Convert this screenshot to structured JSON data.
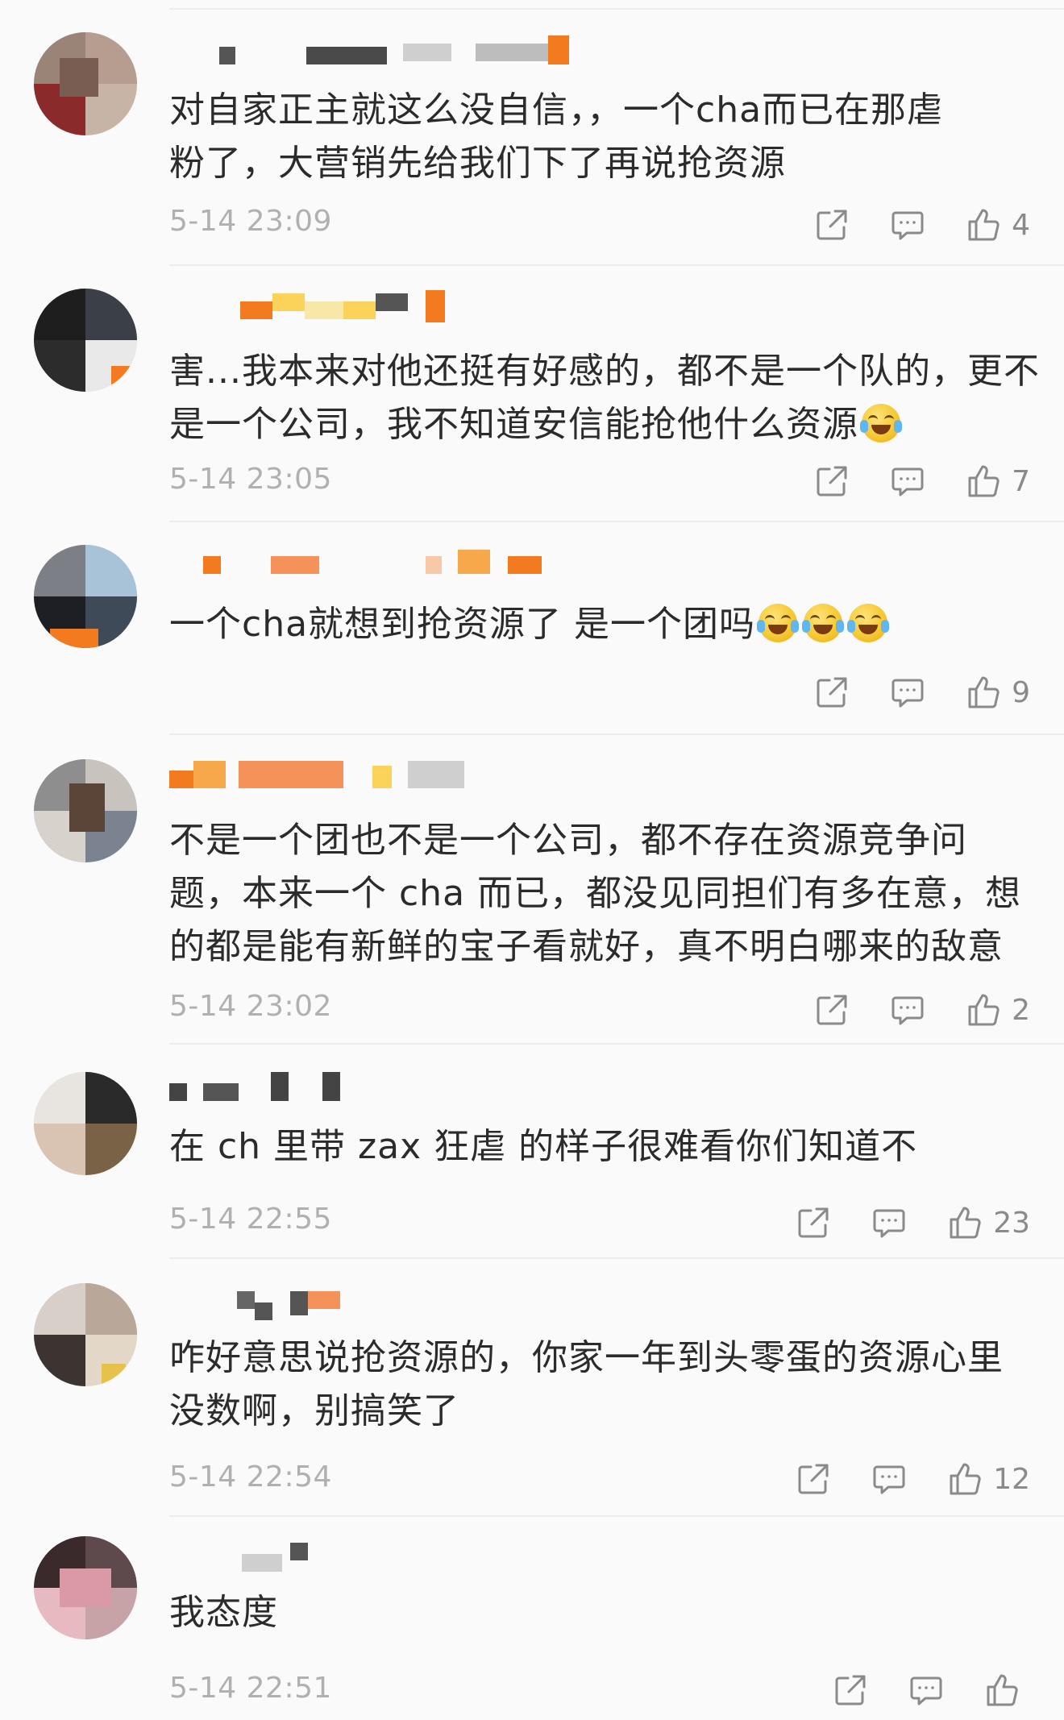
{
  "comments": [
    {
      "content": "对自家正主就这么没自信，，一个cha而已在那虐\n粉了，大营销先给我们下了再说抢资源",
      "time": "5-14 23:09",
      "likes": "4"
    },
    {
      "content": "害...我本来对他还挺有好感的，都不是一个队的，更不\n是一个公司，我不知道安信能抢他什么资源",
      "time": "5-14 23:05",
      "likes": "7"
    },
    {
      "content": "一个cha就想到抢资源了 是一个团吗",
      "time": "",
      "likes": "9"
    },
    {
      "content": "不是一个团也不是一个公司，都不存在资源竞争问\n题，本来一个 cha 而已，都没见同担们有多在意，想\n的都是能有新鲜的宝子看就好，真不明白哪来的敌意",
      "time": "5-14 23:02",
      "likes": "2"
    },
    {
      "content": "在 ch 里带 zax 狂虐 的样子很难看你们知道不",
      "time": "5-14 22:55",
      "likes": "23"
    },
    {
      "content": "咋好意思说抢资源的，你家一年到头零蛋的资源心里\n没数啊，别搞笑了",
      "time": "5-14 22:54",
      "likes": "12"
    },
    {
      "content": "我态度",
      "time": "5-14 22:51",
      "likes": ""
    }
  ],
  "icons": {
    "share": "share-icon",
    "comment": "comment-bubble-icon",
    "like": "thumbs-up-icon"
  },
  "colors": {
    "background": "#fafafa",
    "text": "#2b2b2b",
    "meta": "#b0b0b0",
    "icon": "#8a8a8a",
    "mosaic_orange": "#f47a1f"
  }
}
